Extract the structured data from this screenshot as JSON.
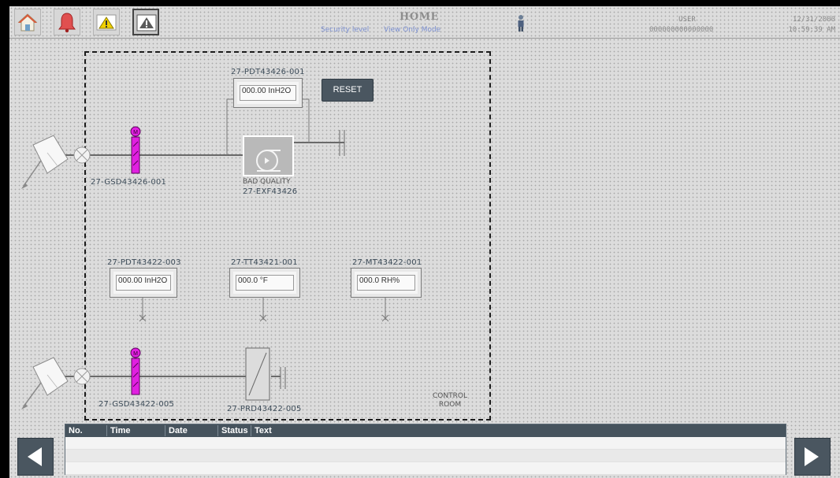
{
  "header": {
    "title": "HOME",
    "security_level": "Security level",
    "mode": "View Only Mode",
    "user_label": "USER",
    "user_id": "000000000000000",
    "date": "12/31/2000",
    "time": "10:59:39 AM",
    "nav_buttons": [
      "home-icon",
      "alarm-bell-icon",
      "warning-icon",
      "acknowledge-warning-icon"
    ]
  },
  "process": {
    "reset_label": "RESET",
    "pdt_426": {
      "tag": "27-PDT43426-001",
      "value": "000.00 InH2O"
    },
    "gsd_426": {
      "tag": "27-GSD43426-001",
      "badge": "M"
    },
    "exf_426": {
      "tag": "27-EXF43426",
      "status": "BAD QUALITY"
    },
    "pdt_422": {
      "tag": "27-PDT43422-003",
      "value": "000.00 InH2O"
    },
    "tt_421": {
      "tag": "27-TT43421-001",
      "value": "000.0 °F"
    },
    "mt_422": {
      "tag": "27-MT43422-001",
      "value": "000.0 RH%"
    },
    "gsd_422": {
      "tag": "27-GSD43422-005",
      "badge": "M"
    },
    "prd_422": {
      "tag": "27-PRD43422-005"
    },
    "area_label_1": "CONTROL",
    "area_label_2": "ROOM"
  },
  "alarm_table": {
    "columns": [
      "No.",
      "Time",
      "Date",
      "Status",
      "Text"
    ],
    "rows": []
  },
  "colors": {
    "accent_dark": "#46535d",
    "damper_magenta": "#e020e0",
    "screen_bg": "#dcdcdc",
    "link_blue": "#7b8fd0"
  }
}
